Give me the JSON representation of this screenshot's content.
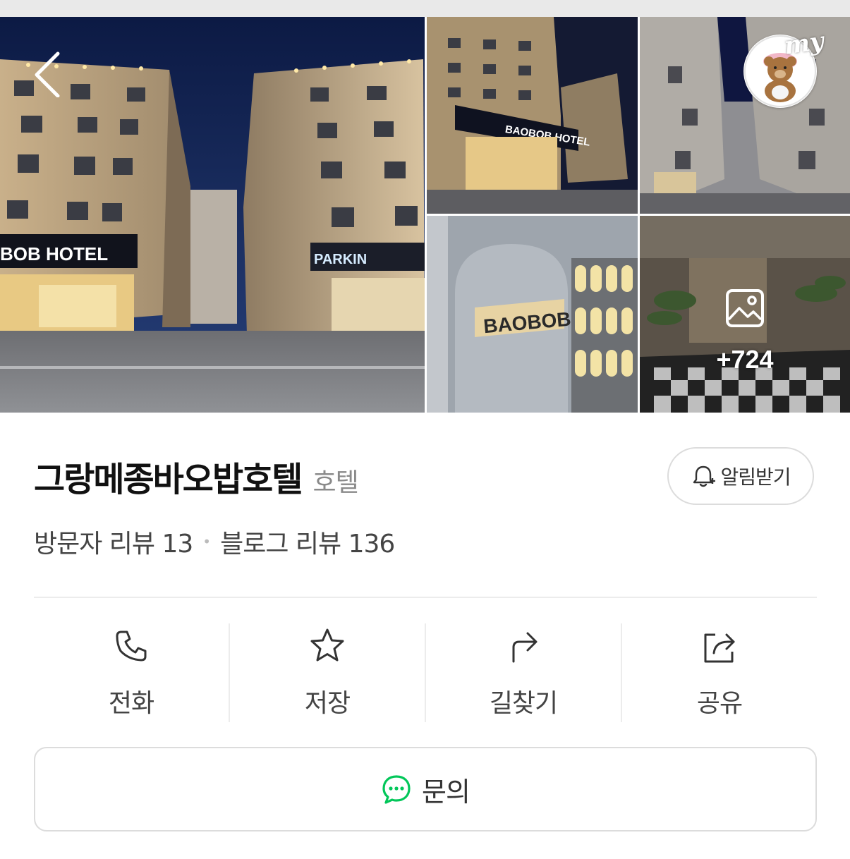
{
  "gallery": {
    "main_sign": "BOB HOTEL",
    "parking_sign": "PARKIN",
    "photo2_sign": "BAOBOB HOTEL",
    "photo4_sign": "BAOBOB",
    "more_photos": "+724"
  },
  "my_avatar": {
    "label": "my"
  },
  "place": {
    "name": "그랑메종바오밥호텔",
    "category": "호텔",
    "notify_label": "알림받기"
  },
  "reviews": {
    "visitor": "방문자 리뷰 13",
    "blog": "블로그 리뷰 136"
  },
  "actions": [
    {
      "label": "전화",
      "icon": "phone-icon"
    },
    {
      "label": "저장",
      "icon": "star-icon"
    },
    {
      "label": "길찾기",
      "icon": "directions-icon"
    },
    {
      "label": "공유",
      "icon": "share-icon"
    }
  ],
  "inquiry": {
    "label": "문의",
    "icon": "chat-icon",
    "accent": "#03c75a"
  }
}
